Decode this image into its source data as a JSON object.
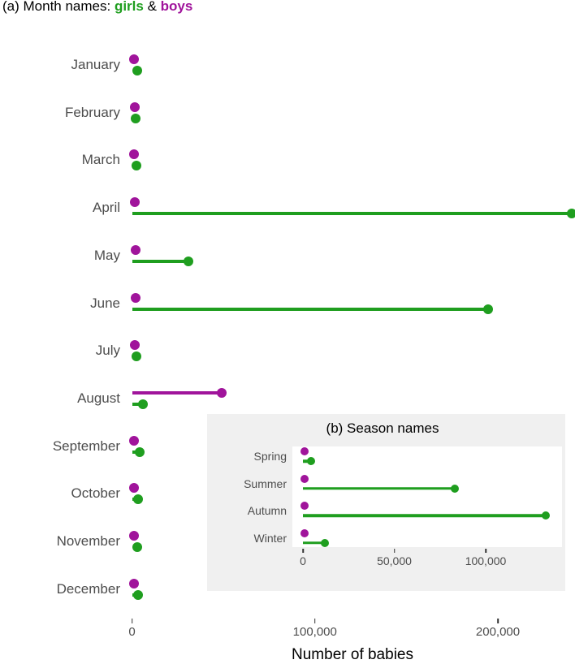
{
  "panel_a": {
    "title_prefix": "(a) Month names: ",
    "title_girls": "girls",
    "title_amp": " & ",
    "title_boys": "boys",
    "xaxis_title": "Number of babies",
    "xticklabels": [
      "0",
      "100,000",
      "200,000"
    ],
    "colors": {
      "girls": "#1f9e1f",
      "boys": "#a0149b",
      "text": "#4d4d4d"
    }
  },
  "panel_b": {
    "title": "(b) Season names",
    "xticklabels": [
      "0",
      "50,000",
      "100,000"
    ],
    "panel_bg": "#f0f0f0",
    "plot_bg": "#ffffff"
  },
  "chart_data": [
    {
      "type": "scatter",
      "id": "panel-a",
      "title": "(a) Month names: girls & boys",
      "xlabel": "Number of babies",
      "ylabel": "",
      "xlim": [
        0,
        245000
      ],
      "xticks": [
        0,
        100000,
        200000
      ],
      "xticklabels": [
        "0",
        "100,000",
        "200,000"
      ],
      "grid": false,
      "legend": "in-title",
      "categories": [
        "January",
        "February",
        "March",
        "April",
        "May",
        "June",
        "July",
        "August",
        "September",
        "October",
        "November",
        "December"
      ],
      "series": [
        {
          "name": "girls",
          "color": "#1f9e1f",
          "values": [
            3000,
            2000,
            2500,
            240400,
            31000,
            194700,
            2500,
            6000,
            4000,
            3500,
            3000,
            3500
          ]
        },
        {
          "name": "boys",
          "color": "#a0149b",
          "values": [
            1000,
            1500,
            1200,
            1500,
            1800,
            2000,
            1500,
            49000,
            1200,
            1000,
            1200,
            1000
          ]
        }
      ]
    },
    {
      "type": "scatter",
      "id": "panel-b",
      "title": "(b) Season names",
      "xlabel": "",
      "ylabel": "",
      "xlim": [
        0,
        142000
      ],
      "xticks": [
        0,
        50000,
        100000
      ],
      "xticklabels": [
        "0",
        "50,000",
        "100,000"
      ],
      "grid": false,
      "legend": "none",
      "categories": [
        "Spring",
        "Summer",
        "Autumn",
        "Winter"
      ],
      "series": [
        {
          "name": "girls",
          "color": "#1f9e1f",
          "values": [
            4500,
            83000,
            133000,
            12000
          ]
        },
        {
          "name": "boys",
          "color": "#a0149b",
          "values": [
            800,
            700,
            800,
            700
          ]
        }
      ]
    }
  ]
}
